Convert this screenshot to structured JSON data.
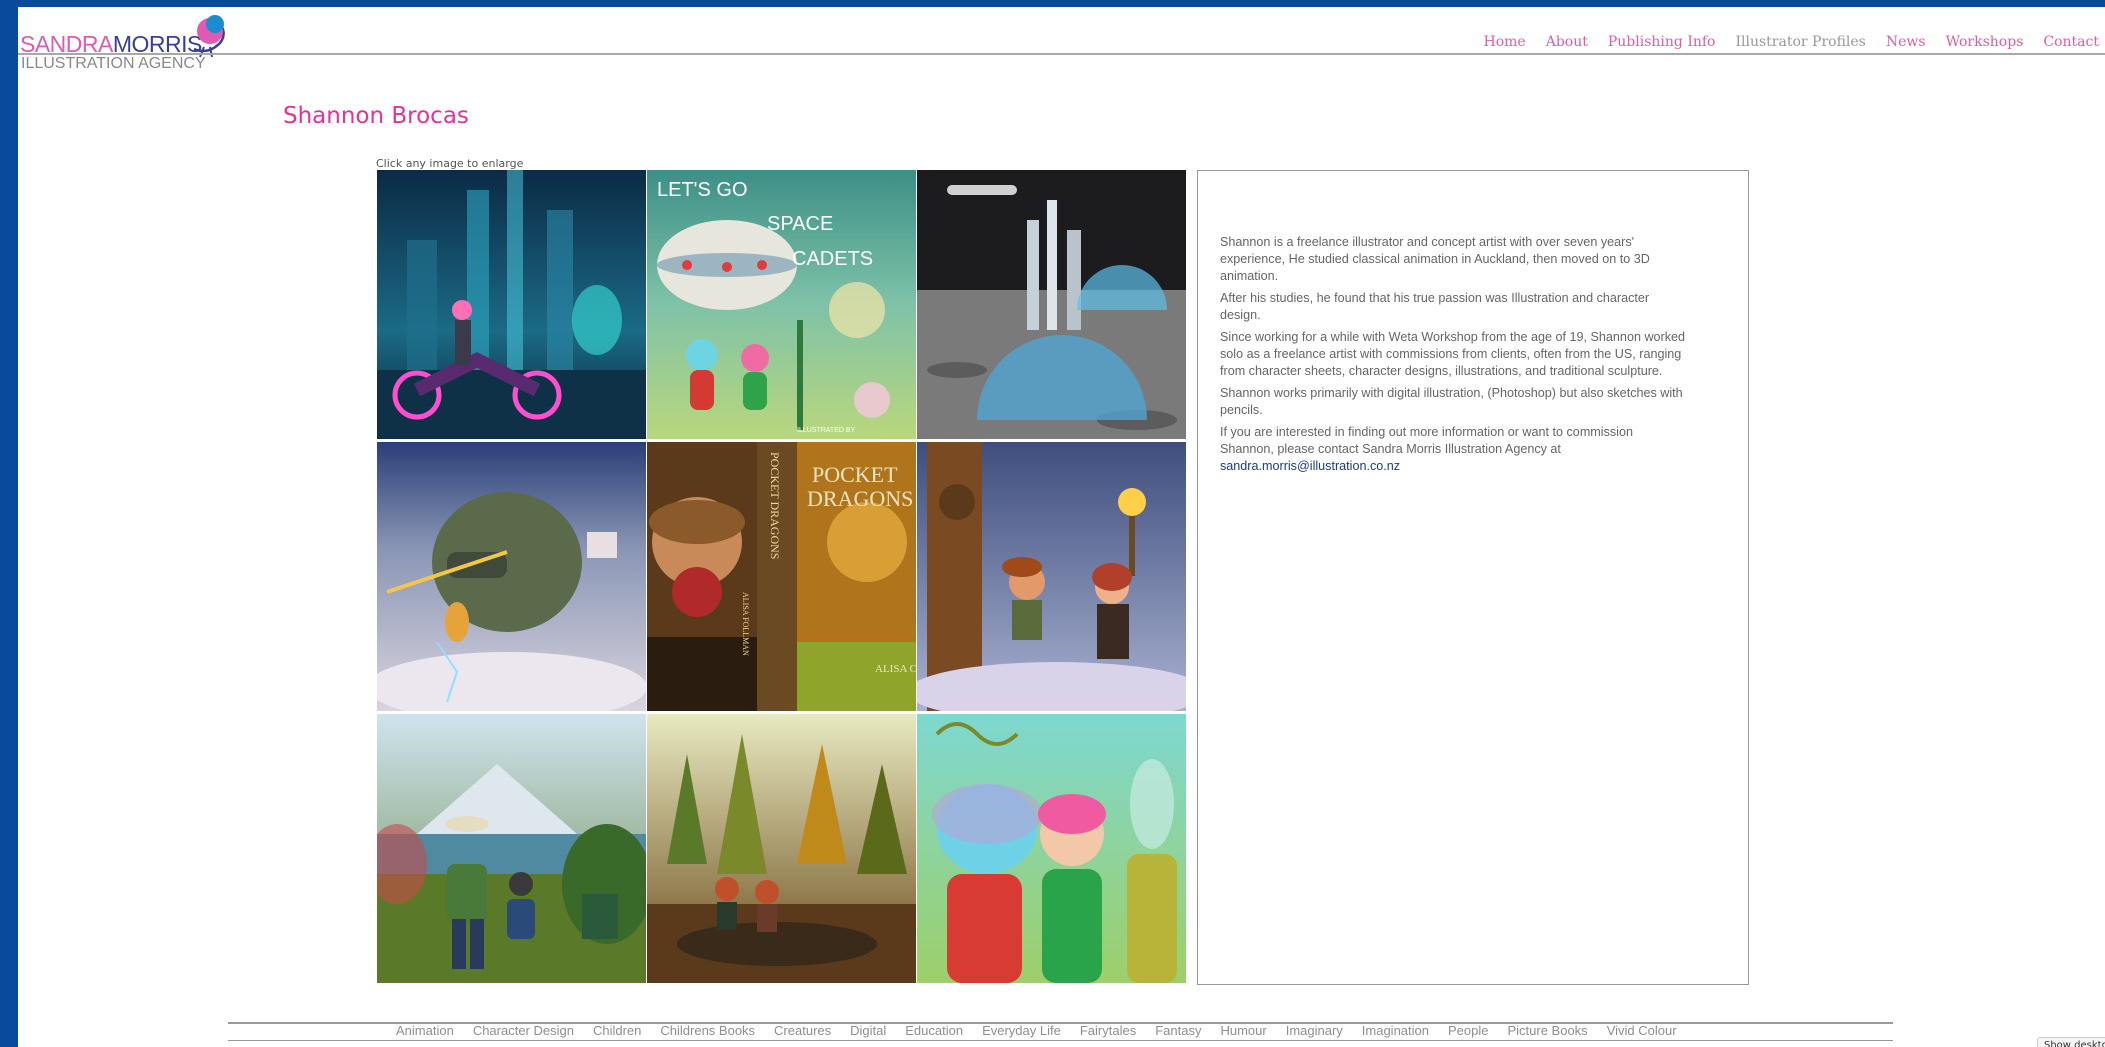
{
  "header": {
    "logo_top_pink": "SANDRA",
    "logo_top_blue": "MORRIS",
    "logo_bottom": "ILLUSTRATION AGENCY",
    "nav": [
      {
        "label": "Home",
        "active": false
      },
      {
        "label": "About",
        "active": false
      },
      {
        "label": "Publishing Info",
        "active": false
      },
      {
        "label": "Illustrator Profiles",
        "active": true
      },
      {
        "label": "News",
        "active": false
      },
      {
        "label": "Workshops",
        "active": false
      },
      {
        "label": "Contact",
        "active": false
      }
    ]
  },
  "main": {
    "title": "Shannon Brocas",
    "hint": "Click any image to enlarge",
    "gallery": [
      {
        "name": "cyberpunk-motorbike-image",
        "text_lines": []
      },
      {
        "name": "space-cadets-cover-image",
        "text_lines": [
          "LET'S GO",
          "SPACE",
          "CADETS",
          "ILLUSTRATED BY"
        ]
      },
      {
        "name": "moon-base-image",
        "text_lines": []
      },
      {
        "name": "monkey-king-image",
        "text_lines": []
      },
      {
        "name": "pocket-dragons-cover-image",
        "text_lines": [
          "POCKET",
          "DRAGONS",
          "POCKET DRAGONS",
          "ALISA FOLLMAN",
          "ALISA C"
        ]
      },
      {
        "name": "kids-with-torch-image",
        "text_lines": []
      },
      {
        "name": "hiking-kids-image",
        "text_lines": []
      },
      {
        "name": "forest-river-kids-image",
        "text_lines": []
      },
      {
        "name": "space-cadets-characters-image",
        "text_lines": []
      }
    ],
    "bio": {
      "p1": "Shannon is a freelance illustrator and concept artist with over seven years' experience, He studied classical animation in Auckland, then moved on to 3D animation.",
      "p2": "After his studies, he found that his true passion was Illustration and character design.",
      "p3": "Since working for a while with Weta Workshop from the age of 19, Shannon worked solo as a freelance artist with commissions from clients, often from the US, ranging from character sheets, character designs, illustrations, and traditional sculpture.",
      "p4": "Shannon works primarily with digital illustration, (Photoshop) but also sketches with pencils.",
      "p5_text": "If you are interested in finding out more information or want to commission Shannon, please contact Sandra Morris Illustration Agency at ",
      "p5_link": "sandra.morris@illustration.co.nz"
    }
  },
  "footer": {
    "tags": [
      "Animation",
      "Character Design",
      "Children",
      "Childrens Books",
      "Creatures",
      "Digital",
      "Education",
      "Everyday Life",
      "Fairytales",
      "Fantasy",
      "Humour",
      "Imaginary",
      "Imagination",
      "People",
      "Picture Books",
      "Vivid Colour"
    ]
  },
  "show_desktop_label": "Show desktop",
  "colors": {
    "outer_frame": "#0a4a9c",
    "brand_pink": "#e6309c",
    "nav_pink": "#e35aa9",
    "logo_blue": "#3a3f9a",
    "link_blue": "#1a3a9a"
  }
}
